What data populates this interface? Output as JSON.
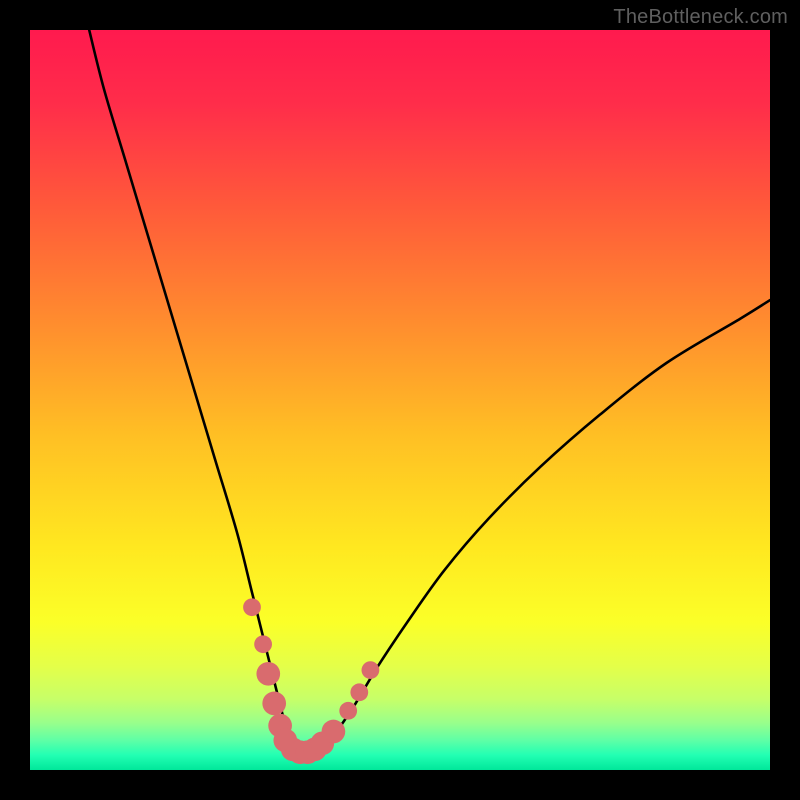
{
  "attribution": "TheBottleneck.com",
  "gradient": {
    "stops": [
      {
        "offset": 0.0,
        "color": "#ff1a4e"
      },
      {
        "offset": 0.1,
        "color": "#ff2d4a"
      },
      {
        "offset": 0.24,
        "color": "#ff5a3a"
      },
      {
        "offset": 0.4,
        "color": "#ff8e2e"
      },
      {
        "offset": 0.55,
        "color": "#ffc024"
      },
      {
        "offset": 0.7,
        "color": "#ffe820"
      },
      {
        "offset": 0.8,
        "color": "#fbff28"
      },
      {
        "offset": 0.86,
        "color": "#e4ff49"
      },
      {
        "offset": 0.905,
        "color": "#c6ff69"
      },
      {
        "offset": 0.936,
        "color": "#99ff8b"
      },
      {
        "offset": 0.96,
        "color": "#5effa6"
      },
      {
        "offset": 0.98,
        "color": "#22ffb3"
      },
      {
        "offset": 1.0,
        "color": "#00e79a"
      }
    ]
  },
  "chart_data": {
    "type": "line",
    "title": "",
    "xlabel": "",
    "ylabel": "",
    "xlim": [
      0,
      100
    ],
    "ylim": [
      0,
      100
    ],
    "grid": false,
    "legend": null,
    "series": [
      {
        "name": "bottleneck-curve",
        "x": [
          8,
          10,
          13,
          16,
          19,
          22,
          25,
          28,
          30,
          32,
          33.5,
          34.5,
          35.2,
          36,
          37,
          38,
          39,
          40.5,
          42,
          44,
          47,
          51,
          56,
          62,
          69,
          77,
          86,
          96,
          100
        ],
        "y": [
          100,
          92,
          82,
          72,
          62,
          52,
          42,
          32,
          24,
          16,
          10,
          6,
          3.5,
          2.5,
          2.2,
          2.3,
          2.8,
          4,
          6,
          9,
          14,
          20,
          27,
          34,
          41,
          48,
          55,
          61,
          63.5
        ]
      }
    ],
    "markers": [
      {
        "x": 30.0,
        "y": 22,
        "r": 1.2
      },
      {
        "x": 31.5,
        "y": 17,
        "r": 1.2
      },
      {
        "x": 32.2,
        "y": 13,
        "r": 1.6
      },
      {
        "x": 33.0,
        "y": 9,
        "r": 1.6
      },
      {
        "x": 33.8,
        "y": 6,
        "r": 1.6
      },
      {
        "x": 34.5,
        "y": 4,
        "r": 1.6
      },
      {
        "x": 35.5,
        "y": 2.8,
        "r": 1.6
      },
      {
        "x": 36.5,
        "y": 2.4,
        "r": 1.6
      },
      {
        "x": 37.5,
        "y": 2.4,
        "r": 1.6
      },
      {
        "x": 38.5,
        "y": 2.8,
        "r": 1.6
      },
      {
        "x": 39.5,
        "y": 3.6,
        "r": 1.6
      },
      {
        "x": 41.0,
        "y": 5.2,
        "r": 1.6
      },
      {
        "x": 43.0,
        "y": 8.0,
        "r": 1.2
      },
      {
        "x": 44.5,
        "y": 10.5,
        "r": 1.2
      },
      {
        "x": 46.0,
        "y": 13.5,
        "r": 1.2
      }
    ],
    "marker_color": "#d96b6e",
    "curve_color": "#000000"
  }
}
